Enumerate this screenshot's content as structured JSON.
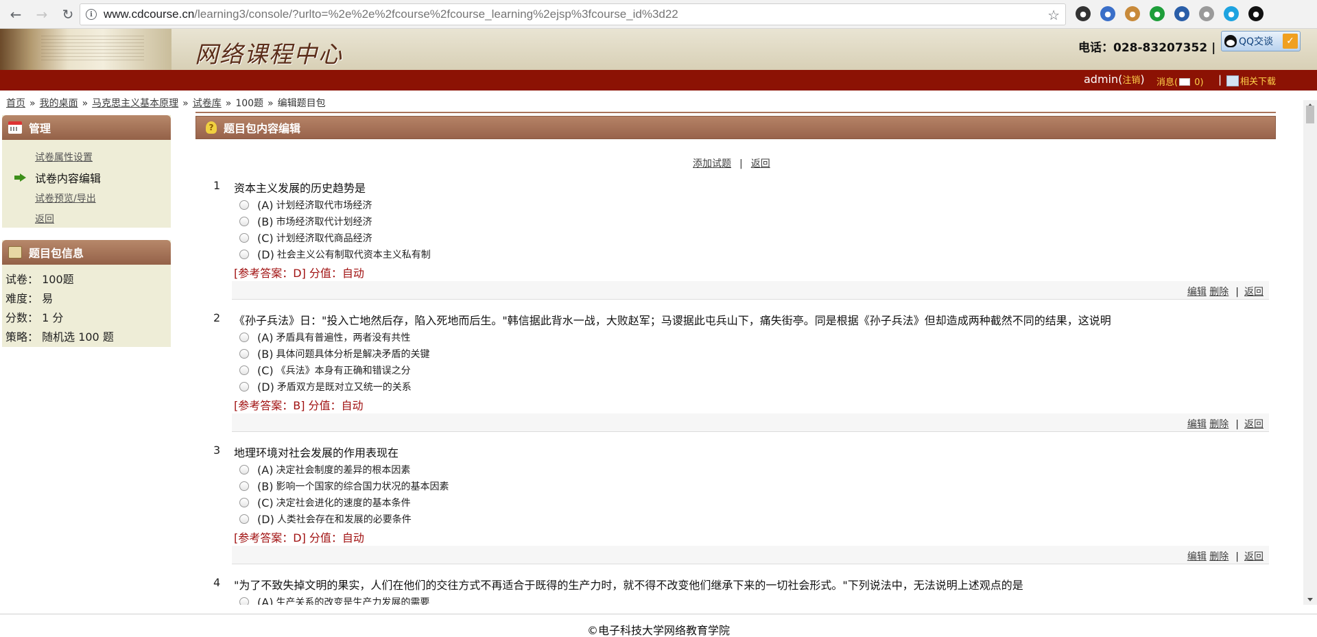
{
  "browser": {
    "url_domain": "www.cdcourse.cn",
    "url_path": "/learning3/console/?urlto=%2e%2e%2fcourse%2fcourse_learning%2ejsp%3fcourse_id%3d22"
  },
  "header": {
    "site_title": "网络课程中心",
    "phone": "电话：028-83207352",
    "phone_sep": "|",
    "qq_label": "QQ交谈"
  },
  "topbar": {
    "user": "admin(",
    "logout": "注销",
    "user_close": ")",
    "messages_prefix": "消息(",
    "messages_count": "0",
    "messages_suffix": ")",
    "sep": "|",
    "download": "相关下载"
  },
  "breadcrumb": {
    "home": "首页",
    "desktop": "我的桌面",
    "course": "马克思主义基本原理",
    "bank": "试卷库",
    "paper": "100题",
    "current": "编辑题目包",
    "sep": "»"
  },
  "sidebar": {
    "manage_title": "管理",
    "items": [
      {
        "label": "试卷属性设置"
      },
      {
        "label": "试卷内容编辑"
      },
      {
        "label": "试卷预览/导出"
      },
      {
        "label": "返回"
      }
    ],
    "info_title": "题目包信息",
    "info": [
      {
        "label": "试卷：",
        "value": "100题"
      },
      {
        "label": "难度：",
        "value": "易"
      },
      {
        "label": "分数：",
        "value": "1 分"
      },
      {
        "label": "策略：",
        "value": "随机选 100 题"
      }
    ]
  },
  "main": {
    "title": "题目包内容编辑",
    "add_label": "添加试题",
    "back_label": "返回",
    "pipe": "|",
    "edit_label": "编辑",
    "delete_label": "删除",
    "questions": [
      {
        "num": "1",
        "text": "资本主义发展的历史趋势是",
        "options": [
          {
            "letter": "(A)",
            "text": "计划经济取代市场经济"
          },
          {
            "letter": "(B)",
            "text": "市场经济取代计划经济"
          },
          {
            "letter": "(C)",
            "text": "计划经济取代商品经济"
          },
          {
            "letter": "(D)",
            "text": "社会主义公有制取代资本主义私有制"
          }
        ],
        "answer": "[参考答案：D]  分值：自动"
      },
      {
        "num": "2",
        "text": "《孙子兵法》日：\"投入亡地然后存，陷入死地而后生。\"韩信据此背水一战，大败赵军；马谡据此屯兵山下，痛失街亭。同是根据《孙子兵法》但却造成两种截然不同的结果，这说明",
        "options": [
          {
            "letter": "(A)",
            "text": "矛盾具有普遍性，两者没有共性"
          },
          {
            "letter": "(B)",
            "text": "具体问题具体分析是解决矛盾的关键"
          },
          {
            "letter": "(C)",
            "text": "《兵法》本身有正确和错误之分"
          },
          {
            "letter": "(D)",
            "text": "矛盾双方是既对立又统一的关系"
          }
        ],
        "answer": "[参考答案：B]  分值：自动"
      },
      {
        "num": "3",
        "text": "地理环境对社会发展的作用表现在",
        "options": [
          {
            "letter": "(A)",
            "text": "决定社会制度的差异的根本因素"
          },
          {
            "letter": "(B)",
            "text": "影响一个国家的综合国力状况的基本因素"
          },
          {
            "letter": "(C)",
            "text": "决定社会进化的速度的基本条件"
          },
          {
            "letter": "(D)",
            "text": "人类社会存在和发展的必要条件"
          }
        ],
        "answer": "[参考答案：D]  分值：自动"
      },
      {
        "num": "4",
        "text": "\"为了不致失掉文明的果实，人们在他们的交往方式不再适合于既得的生产力时，就不得不改变他们继承下来的一切社会形式。\"下列说法中，无法说明上述观点的是",
        "options": [
          {
            "letter": "(A)",
            "text": "生产关系的改变是生产力发展的需要"
          }
        ]
      }
    ]
  },
  "footer": {
    "text": "©电子科技大学网络教育学院"
  }
}
